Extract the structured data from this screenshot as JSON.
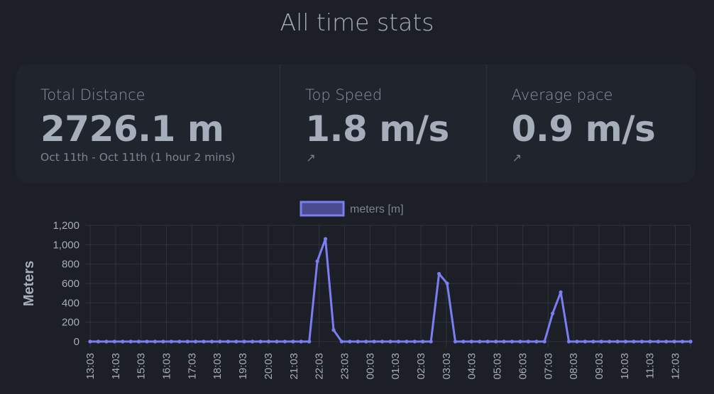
{
  "page_title": "All time stats",
  "stats": [
    {
      "title": "Total Distance",
      "value": "2726.1 m",
      "desc": "Oct 11th - Oct 11th (1 hour 2 mins)"
    },
    {
      "title": "Top Speed",
      "value": "1.8 m/s",
      "icon": "trend-arrow-icon",
      "icon_glyph": "↗"
    },
    {
      "title": "Average pace",
      "value": "0.9 m/s",
      "icon": "trend-arrow-icon",
      "icon_glyph": "↗"
    }
  ],
  "colors": {
    "background": "#1c1f26",
    "card": "#20242d",
    "line": "#7b7ef2",
    "legend_fill": "#4a4c8f",
    "grid": "#2f333c",
    "text": "#a6adbb"
  },
  "chart_data": {
    "type": "line",
    "legend": "meters [m]",
    "legend_position": "top",
    "ylabel": "Meters",
    "ylim": [
      0,
      1200
    ],
    "yticks": [
      0,
      200,
      400,
      600,
      800,
      1000,
      1200
    ],
    "ytick_labels": [
      "0",
      "200",
      "400",
      "600",
      "800",
      "1,000",
      "1,200"
    ],
    "grid": true,
    "xtick_labels": [
      "13:03",
      "14:03",
      "15:03",
      "16:03",
      "17:03",
      "18:03",
      "19:03",
      "20:03",
      "21:03",
      "22:03",
      "23:03",
      "00:03",
      "01:03",
      "02:03",
      "03:03",
      "04:03",
      "05:03",
      "06:03",
      "07:03",
      "08:03",
      "09:03",
      "10:03",
      "11:03",
      "12:03"
    ],
    "series": [
      {
        "name": "meters [m]",
        "values": [
          0,
          0,
          0,
          0,
          0,
          0,
          0,
          0,
          0,
          0,
          0,
          0,
          0,
          0,
          0,
          0,
          0,
          0,
          0,
          0,
          0,
          0,
          0,
          0,
          0,
          0,
          0,
          0,
          830,
          1060,
          120,
          0,
          0,
          0,
          0,
          0,
          0,
          0,
          0,
          0,
          0,
          0,
          0,
          700,
          600,
          0,
          0,
          0,
          0,
          0,
          0,
          0,
          0,
          0,
          0,
          0,
          0,
          290,
          510,
          0,
          0,
          0,
          0,
          0,
          0,
          0,
          0,
          0,
          0,
          0,
          0,
          0,
          0,
          0,
          0
        ]
      }
    ]
  }
}
